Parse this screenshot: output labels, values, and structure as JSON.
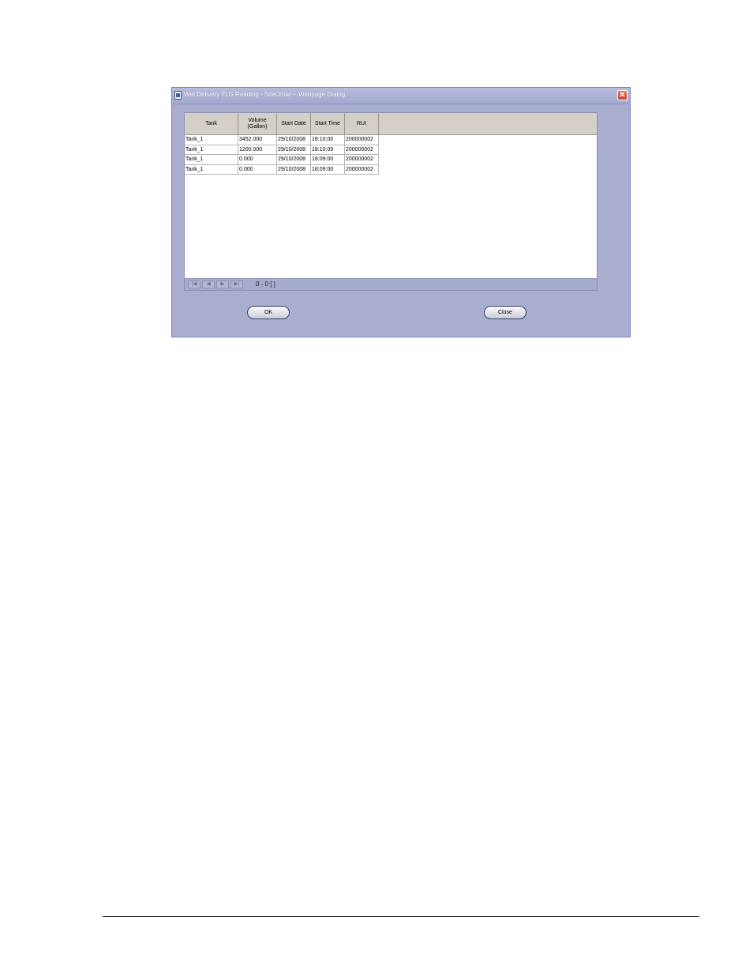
{
  "dialog": {
    "title": "Wet Delivery TLG Reading - SiteOmat -- Webpage Dialog",
    "close_symbol": "✕",
    "icons": {
      "title": "document-icon",
      "close": "close-icon"
    }
  },
  "grid": {
    "columns": [
      "Tank",
      "Volume\n(Gallon)",
      "Start Date",
      "Start Time",
      "RUI"
    ],
    "rows": [
      [
        "Tank_1",
        "3452.000",
        "29/10/2008",
        "18:10:00",
        "200000002"
      ],
      [
        "Tank_1",
        "1200.000",
        "29/10/2008",
        "18:10:00",
        "200000002"
      ],
      [
        "Tank_1",
        "0.000",
        "29/10/2008",
        "18:09:00",
        "200000002"
      ],
      [
        "Tank_1",
        "0.000",
        "29/10/2008",
        "18:09:00",
        "200000002"
      ]
    ]
  },
  "pager": {
    "first": "|◀",
    "prev": "◀",
    "next": "▶",
    "last": "▶|",
    "status": "0 - 0  [ ]"
  },
  "buttons": {
    "ok": "OK",
    "close": "Close"
  },
  "colors": {
    "dialog_bg": "#a9aed0",
    "header_bg": "#d4d0c8",
    "close_red": "#c4422f"
  }
}
